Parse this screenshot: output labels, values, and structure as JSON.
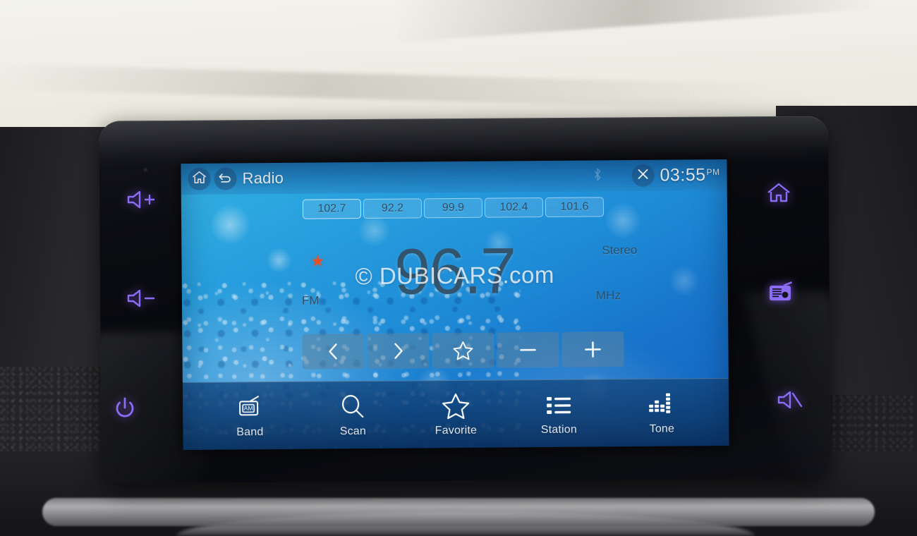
{
  "device": {
    "type": "car-infotainment-head-unit",
    "bezel_keys_left": [
      {
        "name": "volume-up",
        "icon": "speaker-plus-icon"
      },
      {
        "name": "volume-down",
        "icon": "speaker-minus-icon"
      },
      {
        "name": "power",
        "icon": "power-icon"
      }
    ],
    "bezel_keys_right": [
      {
        "name": "home",
        "icon": "home-icon"
      },
      {
        "name": "radio",
        "icon": "radio-icon"
      },
      {
        "name": "mute",
        "icon": "speaker-mute-icon"
      }
    ],
    "backlight_color": "#8b6cf5"
  },
  "statusbar": {
    "home_icon": "home-icon",
    "back_icon": "back-arrow-icon",
    "title": "Radio",
    "bluetooth_icon": "bluetooth-icon",
    "close_icon": "close-x-icon",
    "time": "03:55",
    "ampm": "PM"
  },
  "presets": [
    {
      "label": "102.7",
      "active": true
    },
    {
      "label": "92.2",
      "active": false
    },
    {
      "label": "99.9",
      "active": false
    },
    {
      "label": "102.4",
      "active": false
    },
    {
      "label": "101.6",
      "active": false
    }
  ],
  "tuner": {
    "band": "FM",
    "frequency": "96.7",
    "unit": "MHz",
    "stereo": "Stereo",
    "favorite_marked": true,
    "favorite_star_color": "#f04e23",
    "text_color": "#33566f"
  },
  "controls": [
    {
      "name": "seek-down-button",
      "icon": "chevron-left-icon"
    },
    {
      "name": "seek-up-button",
      "icon": "chevron-right-icon"
    },
    {
      "name": "favorite-toggle-button",
      "icon": "star-outline-icon"
    },
    {
      "name": "tune-down-button",
      "icon": "minus-icon"
    },
    {
      "name": "tune-up-button",
      "icon": "plus-icon"
    }
  ],
  "bottomnav": [
    {
      "label": "Band",
      "icon": "am-radio-icon"
    },
    {
      "label": "Scan",
      "icon": "search-icon"
    },
    {
      "label": "Favorite",
      "icon": "star-outline-icon"
    },
    {
      "label": "Station",
      "icon": "list-icon"
    },
    {
      "label": "Tone",
      "icon": "equalizer-icon"
    }
  ],
  "watermark": {
    "text": "© DUBICARS.com"
  },
  "theme": {
    "screen_blue": "#1f8fdb",
    "statusbar_blue": "#1c69ac",
    "nav_blue": "#0e3e74",
    "accent_white": "#f4fbff"
  }
}
